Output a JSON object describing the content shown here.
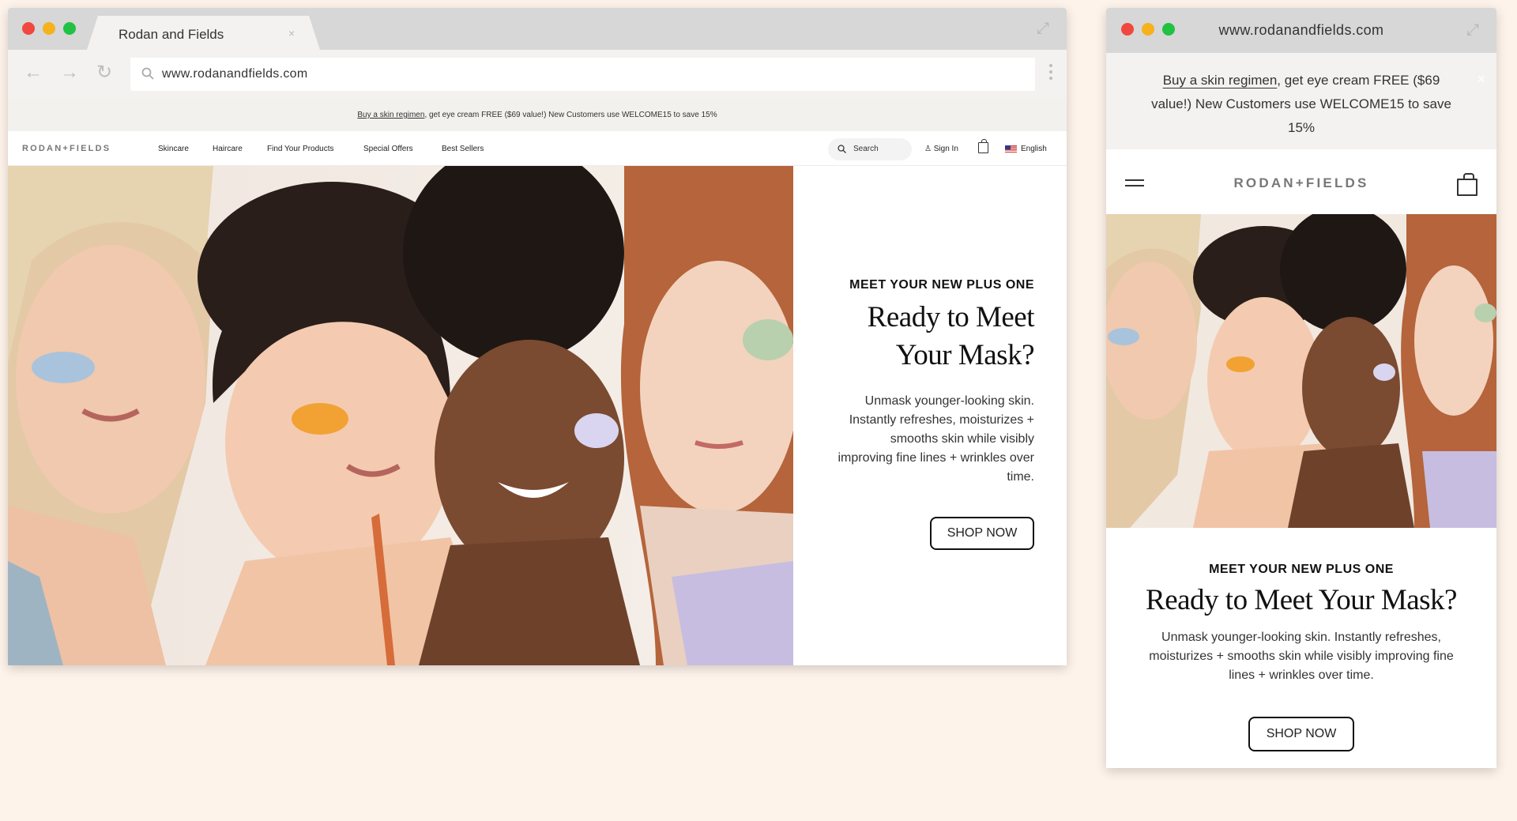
{
  "desktop": {
    "tab_title": "Rodan and Fields",
    "url": "www.rodanandfields.com",
    "banner": {
      "link_text": "Buy a skin regimen",
      "rest_text": ", get eye cream FREE ($69 value!) New Customers use WELCOME15 to save 15%"
    },
    "nav": {
      "logo": "RODAN+FIELDS",
      "links": [
        "Skincare",
        "Haircare",
        "Find Your Products",
        "Special Offers",
        "Best Sellers"
      ],
      "search_placeholder": "Search",
      "sign_in": "Sign In",
      "language": "English"
    },
    "hero": {
      "eyebrow": "MEET YOUR NEW PLUS ONE",
      "headline": "Ready to Meet Your Mask?",
      "body": "Unmask younger-looking skin. Instantly refreshes, moisturizes + smooths skin while visibly improving fine lines + wrinkles over time.",
      "cta": "SHOP NOW"
    }
  },
  "mobile": {
    "url": "www.rodanandfields.com",
    "banner": {
      "link_text": "Buy a skin regimen",
      "rest_text": ", get eye cream FREE ($69 value!) New Customers use WELCOME15 to save 15%"
    },
    "logo": "RODAN+FIELDS",
    "hero": {
      "eyebrow": "MEET YOUR NEW PLUS ONE",
      "headline": "Ready to Meet Your Mask?",
      "body": "Unmask younger-looking skin. Instantly refreshes, moisturizes + smooths skin while visibly improving fine lines + wrinkles over time.",
      "cta": "SHOP NOW"
    }
  },
  "icons": {
    "close": "×",
    "back": "←",
    "forward": "→",
    "reload": "↻",
    "expand": "⤢"
  },
  "colors": {
    "page_bg": "#fdf3ea",
    "chrome_bg": "#d7d7d7",
    "traffic_red": "#f0483f",
    "traffic_yellow": "#f6b21c",
    "traffic_green": "#21c143",
    "mask_blue": "#a9c3dc",
    "mask_orange": "#f2a233",
    "mask_lavender": "#d9d5f0",
    "mask_green": "#b9d0ae"
  }
}
